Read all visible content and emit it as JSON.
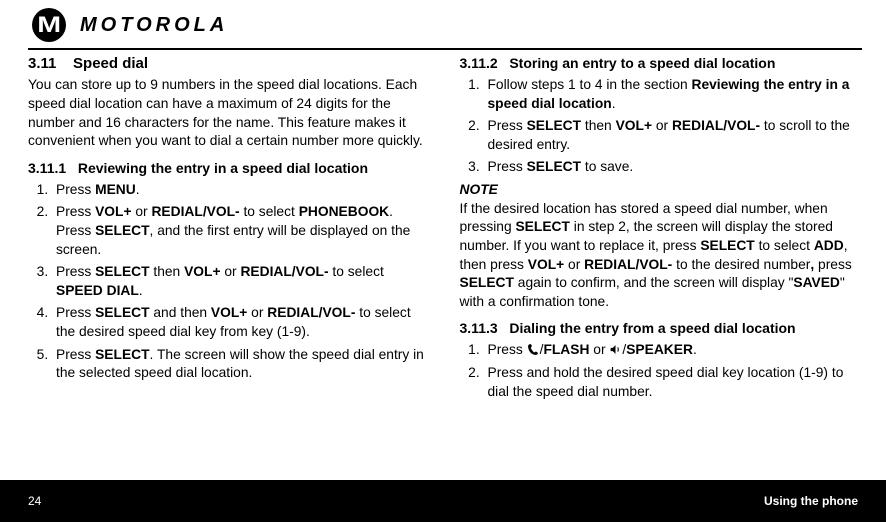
{
  "brand": "MOTOROLA",
  "left": {
    "section_no": "3.11",
    "section_title": "Speed dial",
    "intro": "You can store up to 9 numbers in the speed dial locations. Each speed dial location can have a maximum of 24 digits for the number and 16 characters for the name. This feature makes it convenient when you want to dial a certain number more quickly.",
    "sub_no": "3.11.1",
    "sub_title": "Reviewing the entry in a speed dial location",
    "step1_a": "Press ",
    "step1_b": "MENU",
    "step1_c": ".",
    "step2_a": "Press ",
    "step2_b": "VOL+",
    "step2_c": " or ",
    "step2_d": "REDIAL/VOL-",
    "step2_e": " to select ",
    "step2_f": "PHONEBOOK",
    "step2_g": ".  Press ",
    "step2_h": "SELECT",
    "step2_i": ", and the first entry will be displayed on the screen.",
    "step3_a": "Press ",
    "step3_b": "SELECT",
    "step3_c": " then ",
    "step3_d": "VOL+",
    "step3_e": " or ",
    "step3_f": "REDIAL/VOL-",
    "step3_g": " to select ",
    "step3_h": "SPEED DIAL",
    "step3_i": ".",
    "step4_a": "Press ",
    "step4_b": "SELECT",
    "step4_c": " and then ",
    "step4_d": "VOL+",
    "step4_e": " or ",
    "step4_f": "REDIAL/VOL-",
    "step4_g": " to select the desired speed dial key from key (1-9).",
    "step5_a": "Press ",
    "step5_b": "SELECT",
    "step5_c": ". The screen will show the speed dial entry in the selected speed dial location."
  },
  "right": {
    "sub2_no": "3.11.2",
    "sub2_title": "Storing an entry to a speed dial location",
    "s2_step1_a": "Follow steps 1 to 4 in the section ",
    "s2_step1_b": "Reviewing the entry in a speed dial location",
    "s2_step1_c": ".",
    "s2_step2_a": "Press ",
    "s2_step2_b": "SELECT",
    "s2_step2_c": " then ",
    "s2_step2_d": "VOL+",
    "s2_step2_e": " or ",
    "s2_step2_f": "REDIAL/VOL-",
    "s2_step2_g": " to scroll to the desired entry.",
    "s2_step3_a": "Press ",
    "s2_step3_b": "SELECT",
    "s2_step3_c": " to save.",
    "note_label": "NOTE",
    "note_a": "If the desired location has stored a speed dial number, when pressing ",
    "note_b": "SELECT",
    "note_c": " in step 2, the screen will display the stored number. If you want to replace it, press ",
    "note_d": "SELECT",
    "note_e": " to select ",
    "note_f": "ADD",
    "note_g": ", then press ",
    "note_h": "VOL+",
    "note_i": " or ",
    "note_j": "REDIAL/VOL-",
    "note_k": " to the desired number",
    "note_l": ",",
    "note_m": " press ",
    "note_n": "SELECT",
    "note_o": " again to confirm, and the screen will display \"",
    "note_p": "SAVED",
    "note_q": "\" with a confirmation tone.",
    "sub3_no": "3.11.3",
    "sub3_title": "Dialing the entry from a speed dial location",
    "s3_step1_a": "Press ",
    "s3_step1_b": "/",
    "s3_step1_c": "FLASH",
    "s3_step1_d": " or ",
    "s3_step1_e": "/",
    "s3_step1_f": "SPEAKER",
    "s3_step1_g": ".",
    "s3_step2": "Press and hold the desired speed dial key location (1-9) to dial the speed dial number."
  },
  "footer": {
    "page": "24",
    "label": "Using the phone"
  }
}
